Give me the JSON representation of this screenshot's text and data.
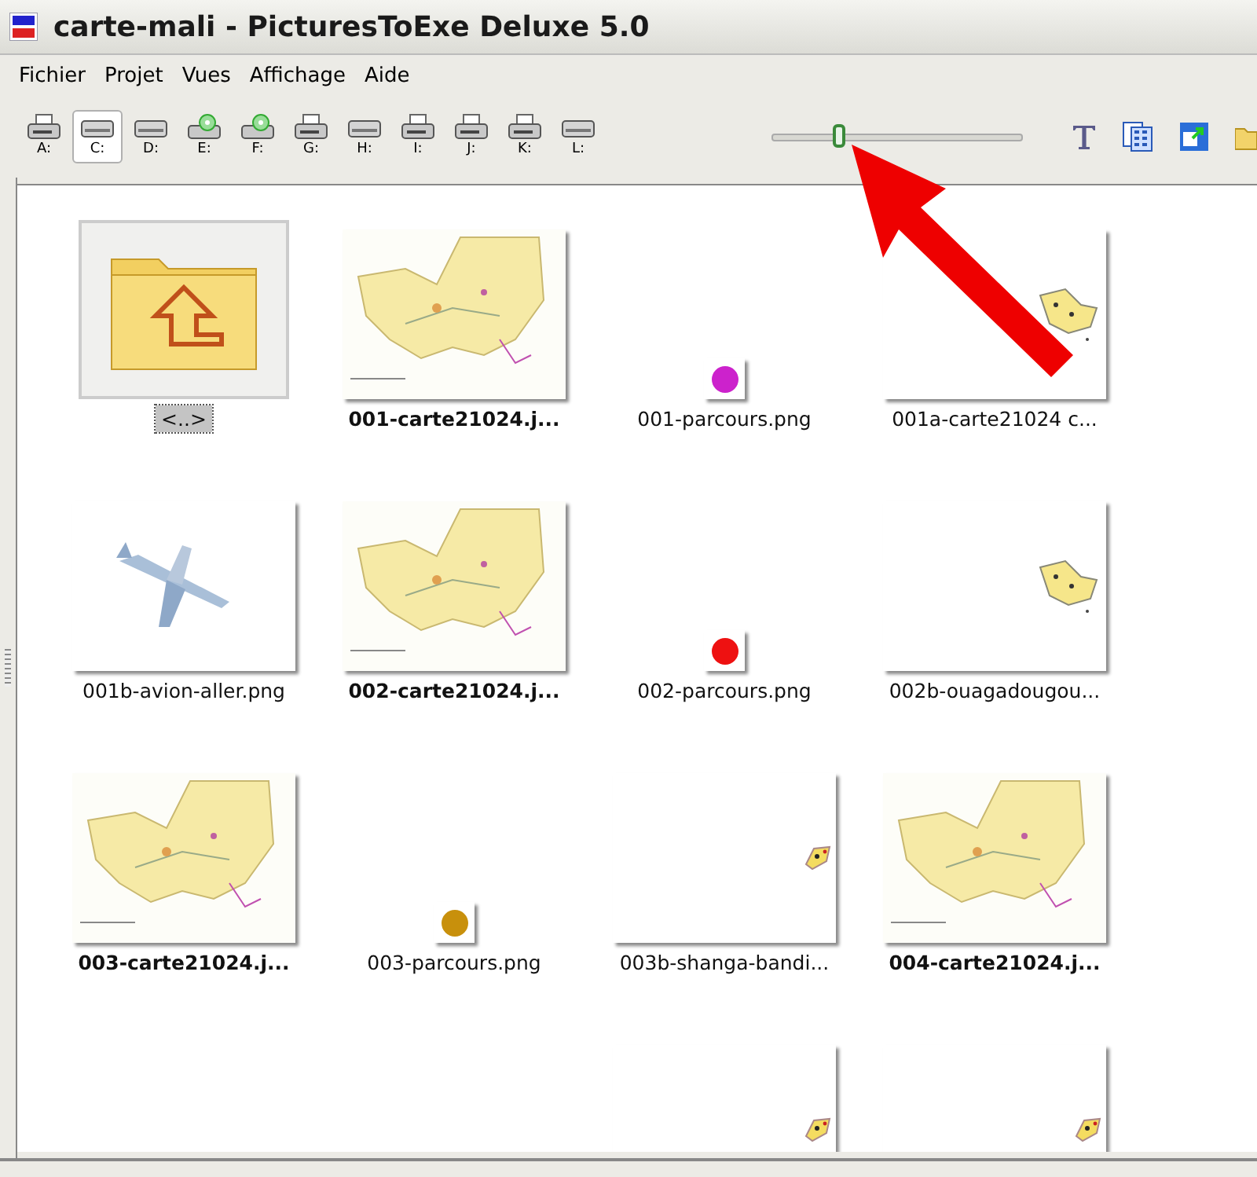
{
  "window": {
    "title": "carte-mali - PicturesToExe Deluxe 5.0"
  },
  "menu": [
    "Fichier",
    "Projet",
    "Vues",
    "Affichage",
    "Aide"
  ],
  "drives": [
    {
      "label": "A:",
      "kind": "floppy",
      "selected": false
    },
    {
      "label": "C:",
      "kind": "disk",
      "selected": true
    },
    {
      "label": "D:",
      "kind": "disk",
      "selected": false
    },
    {
      "label": "E:",
      "kind": "cd",
      "selected": false
    },
    {
      "label": "F:",
      "kind": "cd",
      "selected": false
    },
    {
      "label": "G:",
      "kind": "floppy",
      "selected": false
    },
    {
      "label": "H:",
      "kind": "disk",
      "selected": false
    },
    {
      "label": "I:",
      "kind": "floppy",
      "selected": false
    },
    {
      "label": "J:",
      "kind": "floppy",
      "selected": false
    },
    {
      "label": "K:",
      "kind": "floppy",
      "selected": false
    },
    {
      "label": "L:",
      "kind": "disk",
      "selected": false
    }
  ],
  "zoom_slider": {
    "level": 0.27
  },
  "files": [
    {
      "name": "<..>",
      "kind": "folder",
      "bold": false,
      "selected": true
    },
    {
      "name": "001-carte21024.j...",
      "kind": "map",
      "bold": true,
      "selected": false
    },
    {
      "name": "001-parcours.png",
      "kind": "dot",
      "color": "#cc22cc",
      "bold": false,
      "selected": false
    },
    {
      "name": "001a-carte21024 c...",
      "kind": "tiny-map",
      "bold": false,
      "selected": false
    },
    {
      "name": "001b-avion-aller.png",
      "kind": "plane",
      "bold": false,
      "selected": false
    },
    {
      "name": "002-carte21024.j...",
      "kind": "map",
      "bold": true,
      "selected": false
    },
    {
      "name": "002-parcours.png",
      "kind": "dot",
      "color": "#ee1111",
      "bold": false,
      "selected": false
    },
    {
      "name": "002b-ouagadougou...",
      "kind": "tiny-map",
      "bold": false,
      "selected": false
    },
    {
      "name": "003-carte21024.j...",
      "kind": "map",
      "bold": true,
      "selected": false
    },
    {
      "name": "003-parcours.png",
      "kind": "dot",
      "color": "#c8900c",
      "bold": false,
      "selected": false
    },
    {
      "name": "003b-shanga-bandi...",
      "kind": "speck",
      "bold": false,
      "selected": false
    },
    {
      "name": "004-carte21024.j...",
      "kind": "map",
      "bold": true,
      "selected": false
    },
    {
      "kind": "empty"
    },
    {
      "kind": "empty"
    },
    {
      "kind": "speck"
    },
    {
      "kind": "speck"
    }
  ],
  "annotation": {
    "kind": "arrow"
  }
}
